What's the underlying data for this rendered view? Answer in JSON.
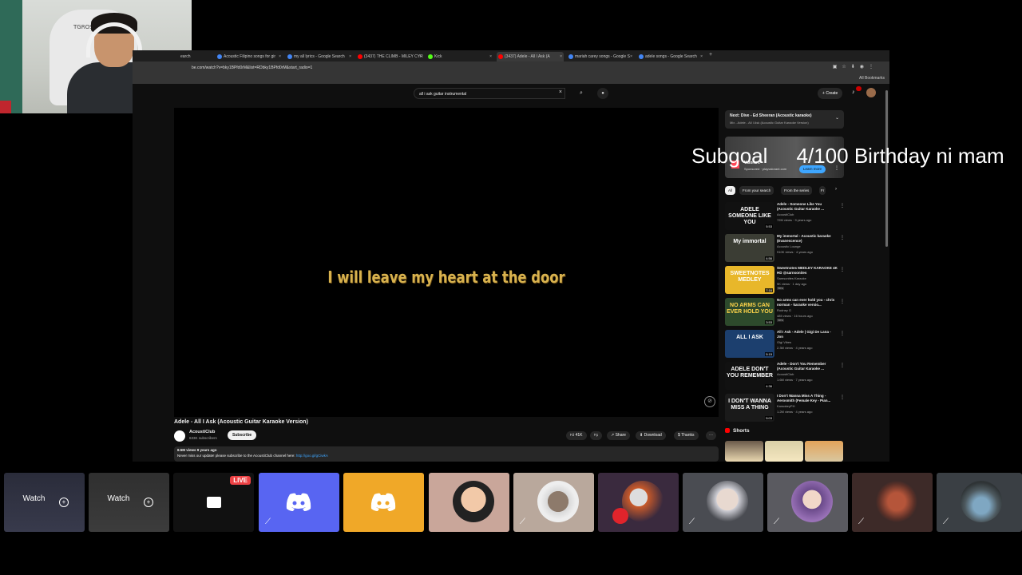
{
  "browser": {
    "tabs": [
      {
        "label": "earch"
      },
      {
        "label": "Acoustic Filipino songs for gir"
      },
      {
        "label": "my all lyrics - Google Search"
      },
      {
        "label": "(3437) THE CLIMB - MILEY CYR"
      },
      {
        "label": "Kick"
      },
      {
        "label": "(3437) Adele - All I Ask (A"
      },
      {
        "label": "mariah carey songs - Google S"
      },
      {
        "label": "adele songs - Google Search"
      }
    ],
    "new_tab": "+",
    "url": "be.com/watch?v=bky1BPfd0rM&list=RDbky1BPfd0rM&start_radio=1",
    "all_bookmarks": "All Bookmarks"
  },
  "youtube": {
    "search_value": "all i ask guitar instrumental",
    "create_label": "Create",
    "lyric": "I will leave my heart at the door",
    "video_title": "Adele - All I Ask (Acoustic Guitar Karaoke Version)",
    "channel_name": "AcoustiClub",
    "channel_subs": "633K subscribers",
    "subscribe_label": "Subscribe",
    "likes": "41K",
    "share_label": "Share",
    "download_label": "Download",
    "thanks_label": "Thanks",
    "views_meta": "8.5M views  9 years ago",
    "desc_text": "Never miss our update! please subscribe to the AcoustiClub channel here: ",
    "desc_link": "http://goo.gl/gCiwkA"
  },
  "sidebar": {
    "next_title": "Next: Dive - Ed Sheeran (Acoustic karaoke)",
    "next_sub": "Mix - Adele - All I Ask (Acoustic Guitar Karaoke Version)",
    "ad_brand": "Valorant",
    "ad_sponsored": "Sponsored · playvalorant.com",
    "ad_cta": "Learn more",
    "chips": [
      "All",
      "From your search",
      "From the series",
      "Fr"
    ],
    "recommendations": [
      {
        "title": "Adele - Someone Like You (Acoustic Guitar Karaoke ...",
        "channel": "AcoustiClub",
        "stats": "72M views · 9 years ago",
        "badge": "",
        "thumb_text": "ADELE SOMEONE LIKE YOU",
        "duration": "5:53",
        "bg": "#111111",
        "fg": "#ffffff"
      },
      {
        "title": "My immortal - Acoustic karaoke (Evanescence)",
        "channel": "Acoustic Lounge",
        "stats": "910K views · 4 years ago",
        "badge": "",
        "thumb_text": "My immortal",
        "duration": "4:56",
        "bg": "#3b3d34",
        "fg": "#ffffff"
      },
      {
        "title": "Sweetnotes MEDLEY KARAOKE 4K HD @sarnsonites",
        "channel": "Samsonites Karaoke",
        "stats": "9K views · 1 day ago",
        "badge": "New",
        "thumb_text": "SWEETNOTES MEDLEY",
        "duration": "7:16",
        "bg": "#e8b72a",
        "fg": "#ffffff"
      },
      {
        "title": "No arms can ever hold you - chris norman - karaoke versio...",
        "channel": "Rodney G",
        "stats": "485 views · 16 hours ago",
        "badge": "New",
        "thumb_text": "NO ARMS CAN EVER HOLD YOU",
        "duration": "3:53",
        "bg": "#2d4a2c",
        "fg": "#ffd54a"
      },
      {
        "title": "All I Ask - Adele | Gigi De Lana - Jon",
        "channel": "Gigi Vibes",
        "stats": "2.3M views · 4 years ago",
        "badge": "",
        "thumb_text": "ALL I ASK",
        "duration": "5:15",
        "bg": "#1c3f6e",
        "fg": "#ffffff"
      },
      {
        "title": "Adele - Don't You Remember (Acoustic Guitar Karaoke ...",
        "channel": "AcoustiClub",
        "stats": "1.6M views · 7 years ago",
        "badge": "",
        "thumb_text": "ADELE DON'T YOU REMEMBER",
        "duration": "4:36",
        "bg": "#111111",
        "fg": "#ffffff"
      },
      {
        "title": "I Don't Wanna Miss A Thing - Aerosmith (Female Key - Pian...",
        "channel": "KaraokeyPH",
        "stats": "1.2M views · 4 years ago",
        "badge": "",
        "thumb_text": "I DON'T WANNA MISS A THING",
        "duration": "5:03",
        "bg": "#1a1a1a",
        "fg": "#ffffff"
      }
    ],
    "shorts_label": "Shorts"
  },
  "overlay": {
    "subgoal": "Subgoal     4/100 Birthday ni mam"
  },
  "discord": {
    "watch_label": "Watch",
    "live_label": "LIVE",
    "colors": {
      "blurple": "#5865f2",
      "yellow": "#f0a828",
      "tile_dark": "#2b2d31",
      "live": "#ed4245"
    }
  }
}
